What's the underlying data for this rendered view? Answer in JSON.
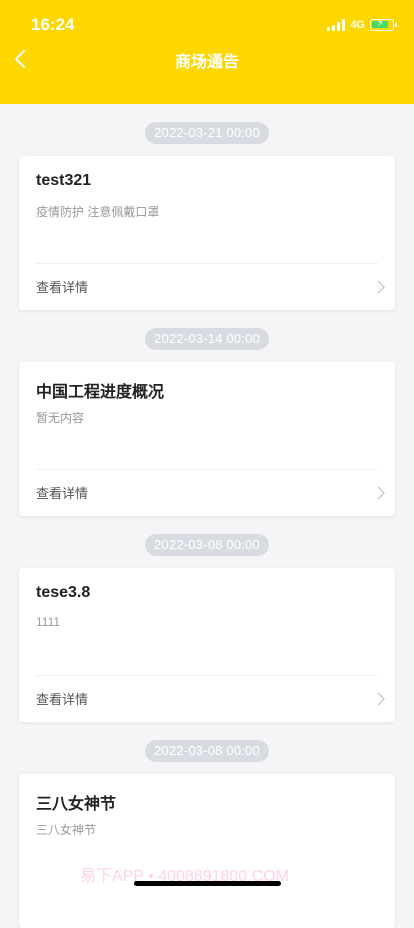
{
  "status_bar": {
    "time": "16:24",
    "network": "4G"
  },
  "nav": {
    "title": "商场通告"
  },
  "notices": [
    {
      "date": "2022-03-21 00:00",
      "title": "test321",
      "desc": "疫情防护 注意佩戴口罩",
      "detail_label": "查看详情"
    },
    {
      "date": "2022-03-14 00:00",
      "title": "中国工程进度概况",
      "desc": "暂无内容",
      "detail_label": "查看详情"
    },
    {
      "date": "2022-03-08 00:00",
      "title": "tese3.8",
      "desc": "1111",
      "detail_label": "查看详情"
    },
    {
      "date": "2022-03-08 00:00",
      "title": "三八女神节",
      "desc": "三八女神节",
      "detail_label": ""
    }
  ],
  "watermark": "易下APP • 4008891800.COM",
  "colors": {
    "header": "#ffd700",
    "background": "#f5f5f7",
    "date_pill": "#d9dbe3"
  }
}
